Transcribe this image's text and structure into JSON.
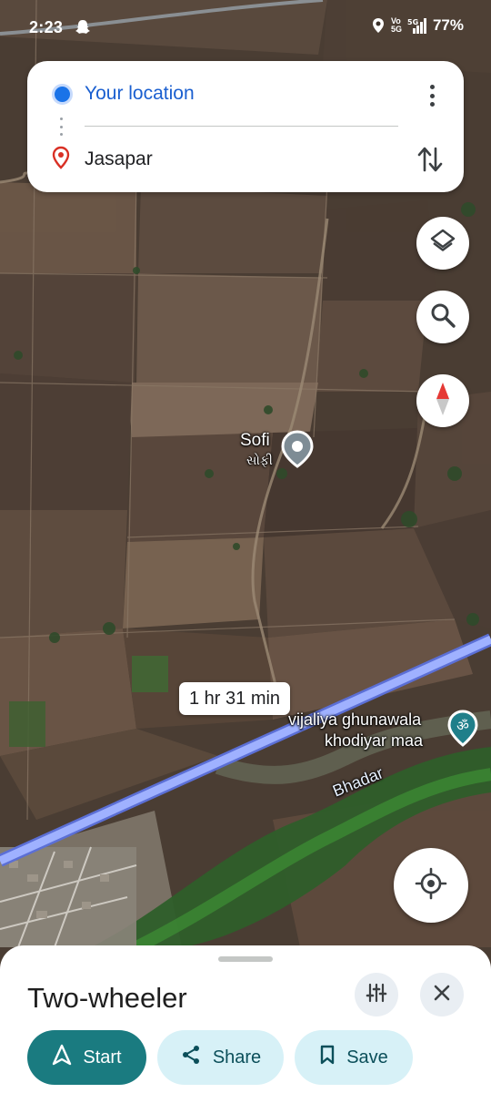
{
  "status_bar": {
    "time": "2:23",
    "network": "Vo 5G",
    "network_gen": "5G",
    "battery": "77%"
  },
  "directions": {
    "origin": "Your location",
    "destination": "Jasapar"
  },
  "map": {
    "places": [
      {
        "name": "Sofi",
        "local_name": "સોફી"
      },
      {
        "name": "vijaliya ghunawala",
        "name_line2": "khodiyar maa"
      }
    ],
    "river": "Bhadar",
    "route_eta": "1 hr 31 min"
  },
  "sheet": {
    "title": "Two-wheeler",
    "start_label": "Start",
    "share_label": "Share",
    "save_label": "Save"
  },
  "colors": {
    "primary_blue": "#1a73e8",
    "route": "#8ea4ff",
    "start_button": "#1a7b80",
    "secondary_button": "#d7f1f7"
  },
  "icons": [
    "snapchat-icon",
    "location-icon",
    "signal-icon",
    "battery-icon",
    "more-vert-icon",
    "swap-icon",
    "layers-icon",
    "search-icon",
    "compass-icon",
    "my-location-icon",
    "tune-icon",
    "close-icon",
    "navigation-icon",
    "share-icon",
    "bookmark-icon",
    "place-pin-icon",
    "temple-icon"
  ]
}
